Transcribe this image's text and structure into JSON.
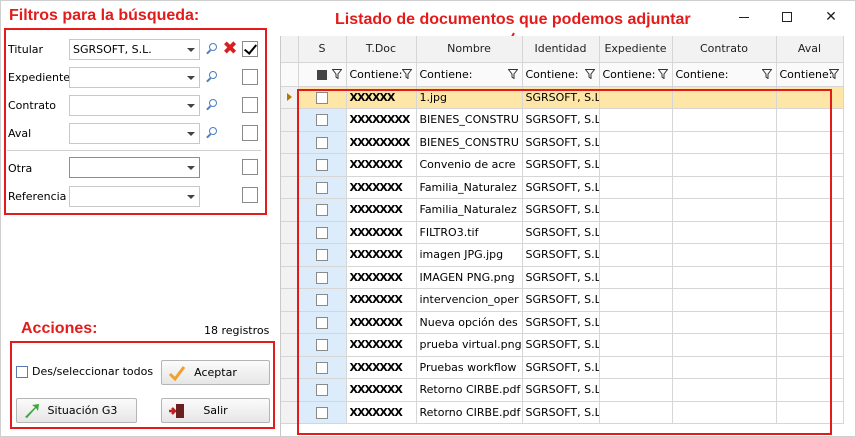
{
  "annotations": {
    "filters_title": "Filtros para la búsqueda:",
    "list_title": "Listado de documentos que podemos adjuntar",
    "actions_title": "Acciones:"
  },
  "filters": {
    "rows": [
      {
        "label": "Titular",
        "value": "SGRSOFT, S.L.",
        "checked": true
      },
      {
        "label": "Expediente",
        "value": "",
        "checked": false
      },
      {
        "label": "Contrato",
        "value": "",
        "checked": false
      },
      {
        "label": "Aval",
        "value": "",
        "checked": false
      },
      {
        "label": "Otra",
        "value": "",
        "checked": false
      },
      {
        "label": "Referencia",
        "value": "",
        "checked": false
      }
    ]
  },
  "status": {
    "count": "18 registros"
  },
  "actions": {
    "select_all": "Des/seleccionar todos",
    "accept": "Aceptar",
    "situation": "Situación G3",
    "exit": "Salir"
  },
  "grid": {
    "columns": [
      "S",
      "T.Doc",
      "Nombre",
      "Identidad",
      "Expediente",
      "Contrato",
      "Aval"
    ],
    "filters": [
      "",
      "Contiene:",
      "Contiene:",
      "Contiene:",
      "Contiene:",
      "Contiene:",
      "Contiene:"
    ],
    "rows": [
      {
        "tdoc": "XXXXXX",
        "nombre": "1.jpg",
        "identidad": "SGRSOFT, S.L.",
        "selected": true
      },
      {
        "tdoc": "XXXXXXXX",
        "nombre": "BIENES_CONSTRU",
        "identidad": "SGRSOFT, S.L."
      },
      {
        "tdoc": "XXXXXXXX",
        "nombre": "BIENES_CONSTRU",
        "identidad": "SGRSOFT, S.L."
      },
      {
        "tdoc": "XXXXXXX",
        "nombre": "Convenio de acre",
        "identidad": "SGRSOFT, S.L."
      },
      {
        "tdoc": "XXXXXXX",
        "nombre": "Familia_Naturalez",
        "identidad": "SGRSOFT, S.L."
      },
      {
        "tdoc": "XXXXXXX",
        "nombre": "Familia_Naturalez",
        "identidad": "SGRSOFT, S.L."
      },
      {
        "tdoc": "XXXXXXX",
        "nombre": "FILTRO3.tif",
        "identidad": "SGRSOFT, S.L."
      },
      {
        "tdoc": "XXXXXXX",
        "nombre": "imagen JPG.jpg",
        "identidad": "SGRSOFT, S.L."
      },
      {
        "tdoc": "XXXXXXX",
        "nombre": "IMAGEN PNG.png",
        "identidad": "SGRSOFT, S.L."
      },
      {
        "tdoc": "XXXXXXX",
        "nombre": "intervencion_oper",
        "identidad": "SGRSOFT, S.L."
      },
      {
        "tdoc": "XXXXXXX",
        "nombre": "Nueva opción des",
        "identidad": "SGRSOFT, S.L."
      },
      {
        "tdoc": "XXXXXXX",
        "nombre": "prueba virtual.png",
        "identidad": "SGRSOFT, S.L."
      },
      {
        "tdoc": "XXXXXXX",
        "nombre": "Pruebas workflow",
        "identidad": "SGRSOFT, S.L."
      },
      {
        "tdoc": "XXXXXXX",
        "nombre": "Retorno CIRBE.pdf",
        "identidad": "SGRSOFT, S.L."
      },
      {
        "tdoc": "XXXXXXX",
        "nombre": "Retorno CIRBE.pdf",
        "identidad": "SGRSOFT, S.L."
      }
    ]
  },
  "colors": {
    "annotation": "#e41b1b",
    "selected_row": "#fde6a6",
    "s_column": "#dcecfb"
  }
}
